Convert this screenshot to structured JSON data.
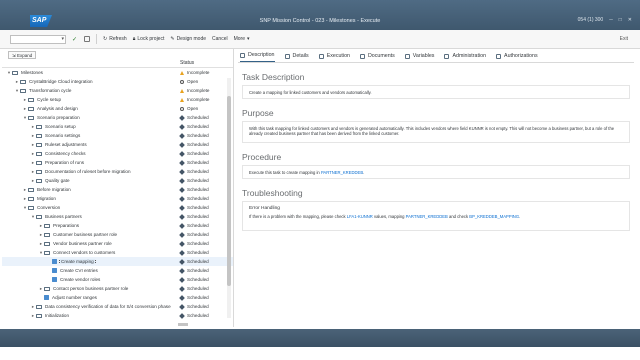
{
  "window": {
    "logo": "SAP",
    "title": "SNP Mission Control - 023 - Milestones - Execute",
    "client_info": "054 (1) 300"
  },
  "toolbar": {
    "refresh": "Refresh",
    "lock_project": "Lock project",
    "design_mode": "Design mode",
    "cancel": "Cancel",
    "more": "More",
    "exit": "Exit"
  },
  "left": {
    "expand": "Expand",
    "col_status": "Status",
    "rows": [
      {
        "twisty": "▾",
        "kind": "folder",
        "level": 0,
        "label": "Milestones",
        "status_icon": "warn",
        "status": "Incomplete"
      },
      {
        "twisty": "▸",
        "kind": "folder",
        "level": 1,
        "label": "CrystalBridge Cloud integration",
        "status_icon": "open",
        "status": "Open"
      },
      {
        "twisty": "▾",
        "kind": "folder",
        "level": 1,
        "label": "Transformation cycle",
        "status_icon": "warn",
        "status": "Incomplete"
      },
      {
        "twisty": "▸",
        "kind": "folder",
        "level": 2,
        "label": "Cycle setup",
        "status_icon": "warn",
        "status": "Incomplete"
      },
      {
        "twisty": "▸",
        "kind": "folder",
        "level": 2,
        "label": "Analysis and design",
        "status_icon": "open",
        "status": "Open"
      },
      {
        "twisty": "▾",
        "kind": "folder",
        "level": 2,
        "label": "Scenario preparation",
        "status_icon": "sched",
        "status": "Scheduled"
      },
      {
        "twisty": "▸",
        "kind": "folder",
        "level": 3,
        "label": "Scenario setup",
        "status_icon": "sched",
        "status": "Scheduled"
      },
      {
        "twisty": "▸",
        "kind": "folder",
        "level": 3,
        "label": "Scenario settings",
        "status_icon": "sched",
        "status": "Scheduled"
      },
      {
        "twisty": "▸",
        "kind": "folder",
        "level": 3,
        "label": "Ruleset adjustments",
        "status_icon": "sched",
        "status": "Scheduled"
      },
      {
        "twisty": "▸",
        "kind": "folder",
        "level": 3,
        "label": "Consistency checks",
        "status_icon": "sched",
        "status": "Scheduled"
      },
      {
        "twisty": "▸",
        "kind": "folder",
        "level": 3,
        "label": "Preparation of runs",
        "status_icon": "sched",
        "status": "Scheduled"
      },
      {
        "twisty": "▸",
        "kind": "folder",
        "level": 3,
        "label": "Documentation of ruleset before migration",
        "status_icon": "sched",
        "status": "Scheduled"
      },
      {
        "twisty": "▸",
        "kind": "folder",
        "level": 3,
        "label": "Quality gate",
        "status_icon": "sched",
        "status": "Scheduled"
      },
      {
        "twisty": "▸",
        "kind": "folder",
        "level": 2,
        "label": "Before migration",
        "status_icon": "sched",
        "status": "Scheduled"
      },
      {
        "twisty": "▸",
        "kind": "folder",
        "level": 2,
        "label": "Migration",
        "status_icon": "sched",
        "status": "Scheduled"
      },
      {
        "twisty": "▾",
        "kind": "folder",
        "level": 2,
        "label": "Conversion",
        "status_icon": "sched",
        "status": "Scheduled"
      },
      {
        "twisty": "▾",
        "kind": "folder",
        "level": 3,
        "label": "Business partners",
        "status_icon": "sched",
        "status": "Scheduled"
      },
      {
        "twisty": "▸",
        "kind": "folder",
        "level": 4,
        "label": "Preparations",
        "status_icon": "sched",
        "status": "Scheduled"
      },
      {
        "twisty": "▸",
        "kind": "folder",
        "level": 4,
        "label": "Customer business partner role",
        "status_icon": "sched",
        "status": "Scheduled"
      },
      {
        "twisty": "▸",
        "kind": "folder",
        "level": 4,
        "label": "Vendor business partner role",
        "status_icon": "sched",
        "status": "Scheduled"
      },
      {
        "twisty": "▾",
        "kind": "folder",
        "level": 4,
        "label": "Connect vendors to customers",
        "status_icon": "sched",
        "status": "Scheduled"
      },
      {
        "twisty": "",
        "kind": "task",
        "level": 5,
        "label": "Create mapping",
        "status_icon": "sched",
        "status": "Scheduled",
        "selected": true
      },
      {
        "twisty": "",
        "kind": "task",
        "level": 5,
        "label": "Create CVI entries",
        "status_icon": "sched",
        "status": "Scheduled"
      },
      {
        "twisty": "",
        "kind": "task",
        "level": 5,
        "label": "Create vendor roles",
        "status_icon": "sched",
        "status": "Scheduled"
      },
      {
        "twisty": "▸",
        "kind": "folder",
        "level": 4,
        "label": "Contact person business partner role",
        "status_icon": "sched",
        "status": "Scheduled"
      },
      {
        "twisty": "",
        "kind": "task",
        "level": 4,
        "label": "Adjust number ranges",
        "status_icon": "sched",
        "status": "Scheduled"
      },
      {
        "twisty": "▸",
        "kind": "folder",
        "level": 3,
        "label": "Data consistency verification of data for S/4 conversion phase",
        "status_icon": "sched",
        "status": "Scheduled"
      },
      {
        "twisty": "▸",
        "kind": "folder",
        "level": 3,
        "label": "Initialization",
        "status_icon": "sched",
        "status": "Scheduled"
      }
    ]
  },
  "right": {
    "tabs": [
      "Description",
      "Details",
      "Execution",
      "Documents",
      "Variables",
      "Administration",
      "Authorizations"
    ],
    "active_tab": 0,
    "task_description_title": "Task Description",
    "task_description_text": "Create a mapping for linked customers and vendors automatically.",
    "purpose_title": "Purpose",
    "purpose_text": "With this task mapping for linked customers and vendors is generated automatically. This includes vendors where field KUNNR is not empty. This will not become a business partner, but a role of the already created business partner that has been derived from the linked customer.",
    "procedure_title": "Procedure",
    "procedure_prefix": "Execute this task to create mapping in ",
    "procedure_link": "PARTNER_KREDDEB",
    "procedure_suffix": ".",
    "troubleshooting_title": "Troubleshooting",
    "error_heading": "Error Handling",
    "error_prefix": "If there is a problem with the mapping, please check ",
    "error_link1": "LFA1-KUNNR",
    "error_mid1": " values, mapping ",
    "error_link2": "PARTNER_KREDDEB",
    "error_mid2": " and check ",
    "error_link3": "BP_KREDDEB_MAPPING",
    "error_suffix": "."
  },
  "colors": {
    "titlebar": "#3f586e",
    "accent": "#346187",
    "warning": "#e9a320",
    "link": "#0a6ed1"
  }
}
